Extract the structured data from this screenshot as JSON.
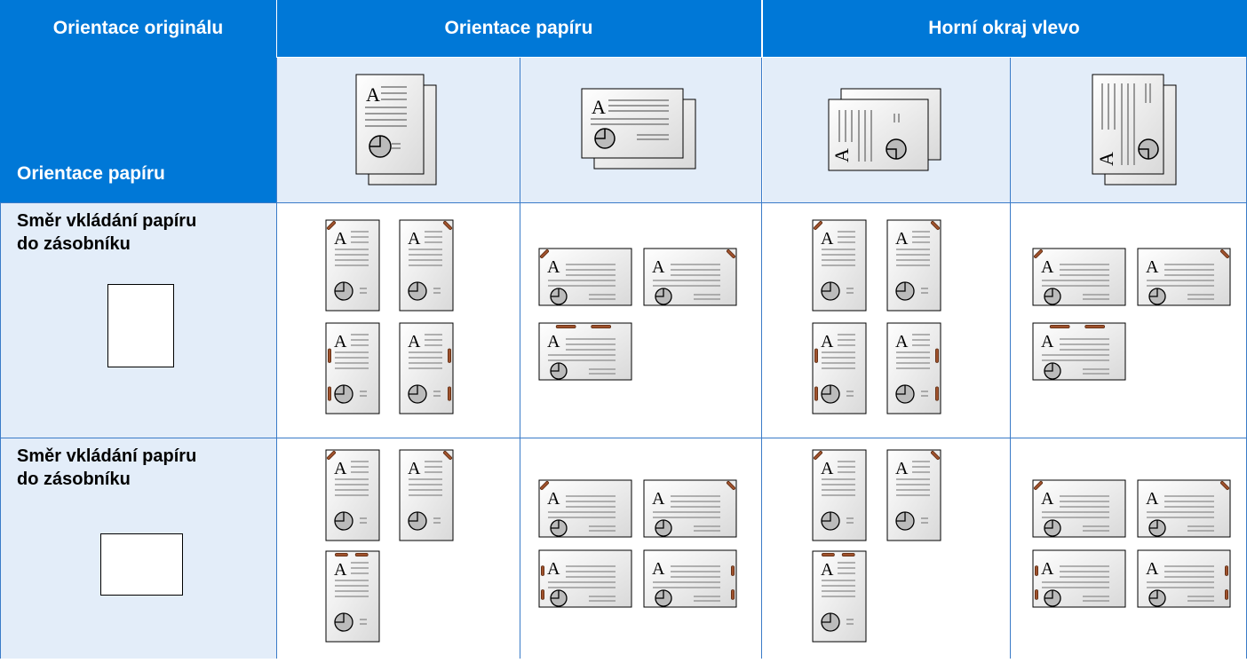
{
  "header": {
    "col_original": "Orientace originálu",
    "col_paper": "Orientace papíru",
    "col_top_left": "Horní okraj vlevo"
  },
  "subheader": {
    "row_label": "Orientace papíru",
    "icon_names": [
      "portrait-pages-icon",
      "landscape-pages-icon",
      "rotated-portrait-pages-icon",
      "rotated-upright-pages-icon"
    ]
  },
  "rows": [
    {
      "label_line1": "Směr vkládání papíru",
      "label_line2": "do zásobníku",
      "tray_icon": "portrait-tray-icon"
    },
    {
      "label_line1": "Směr vkládání papíru",
      "label_line2": "do zásobníku",
      "tray_icon": "landscape-tray-icon"
    }
  ],
  "glyph": "A",
  "colors": {
    "header_bg": "#0078d7",
    "row_header_bg": "#e3edf9",
    "grid_line": "#3a7bc8",
    "staple": "#a0522d"
  }
}
